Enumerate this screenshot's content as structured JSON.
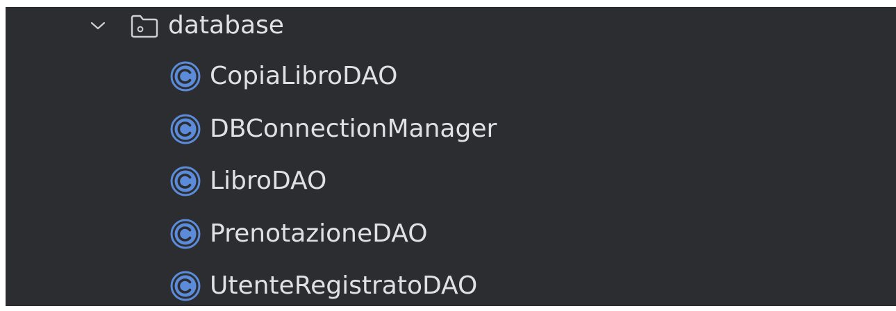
{
  "project_tree": {
    "folder": {
      "label": "database",
      "expanded": true,
      "toggle_icon": "chevron-down-icon",
      "icon": "folder-icon"
    },
    "items": [
      {
        "label": "CopiaLibroDAO",
        "icon": "class-icon"
      },
      {
        "label": "DBConnectionManager",
        "icon": "class-icon"
      },
      {
        "label": "LibroDAO",
        "icon": "class-icon"
      },
      {
        "label": "PrenotazioneDAO",
        "icon": "class-icon"
      },
      {
        "label": "UtenteRegistratoDAO",
        "icon": "class-icon"
      }
    ]
  },
  "colors": {
    "background": "#2b2d30",
    "text": "#dfe1e5",
    "icon_gray": "#ced0d6",
    "class_icon_blue": "#5b8bd9"
  }
}
